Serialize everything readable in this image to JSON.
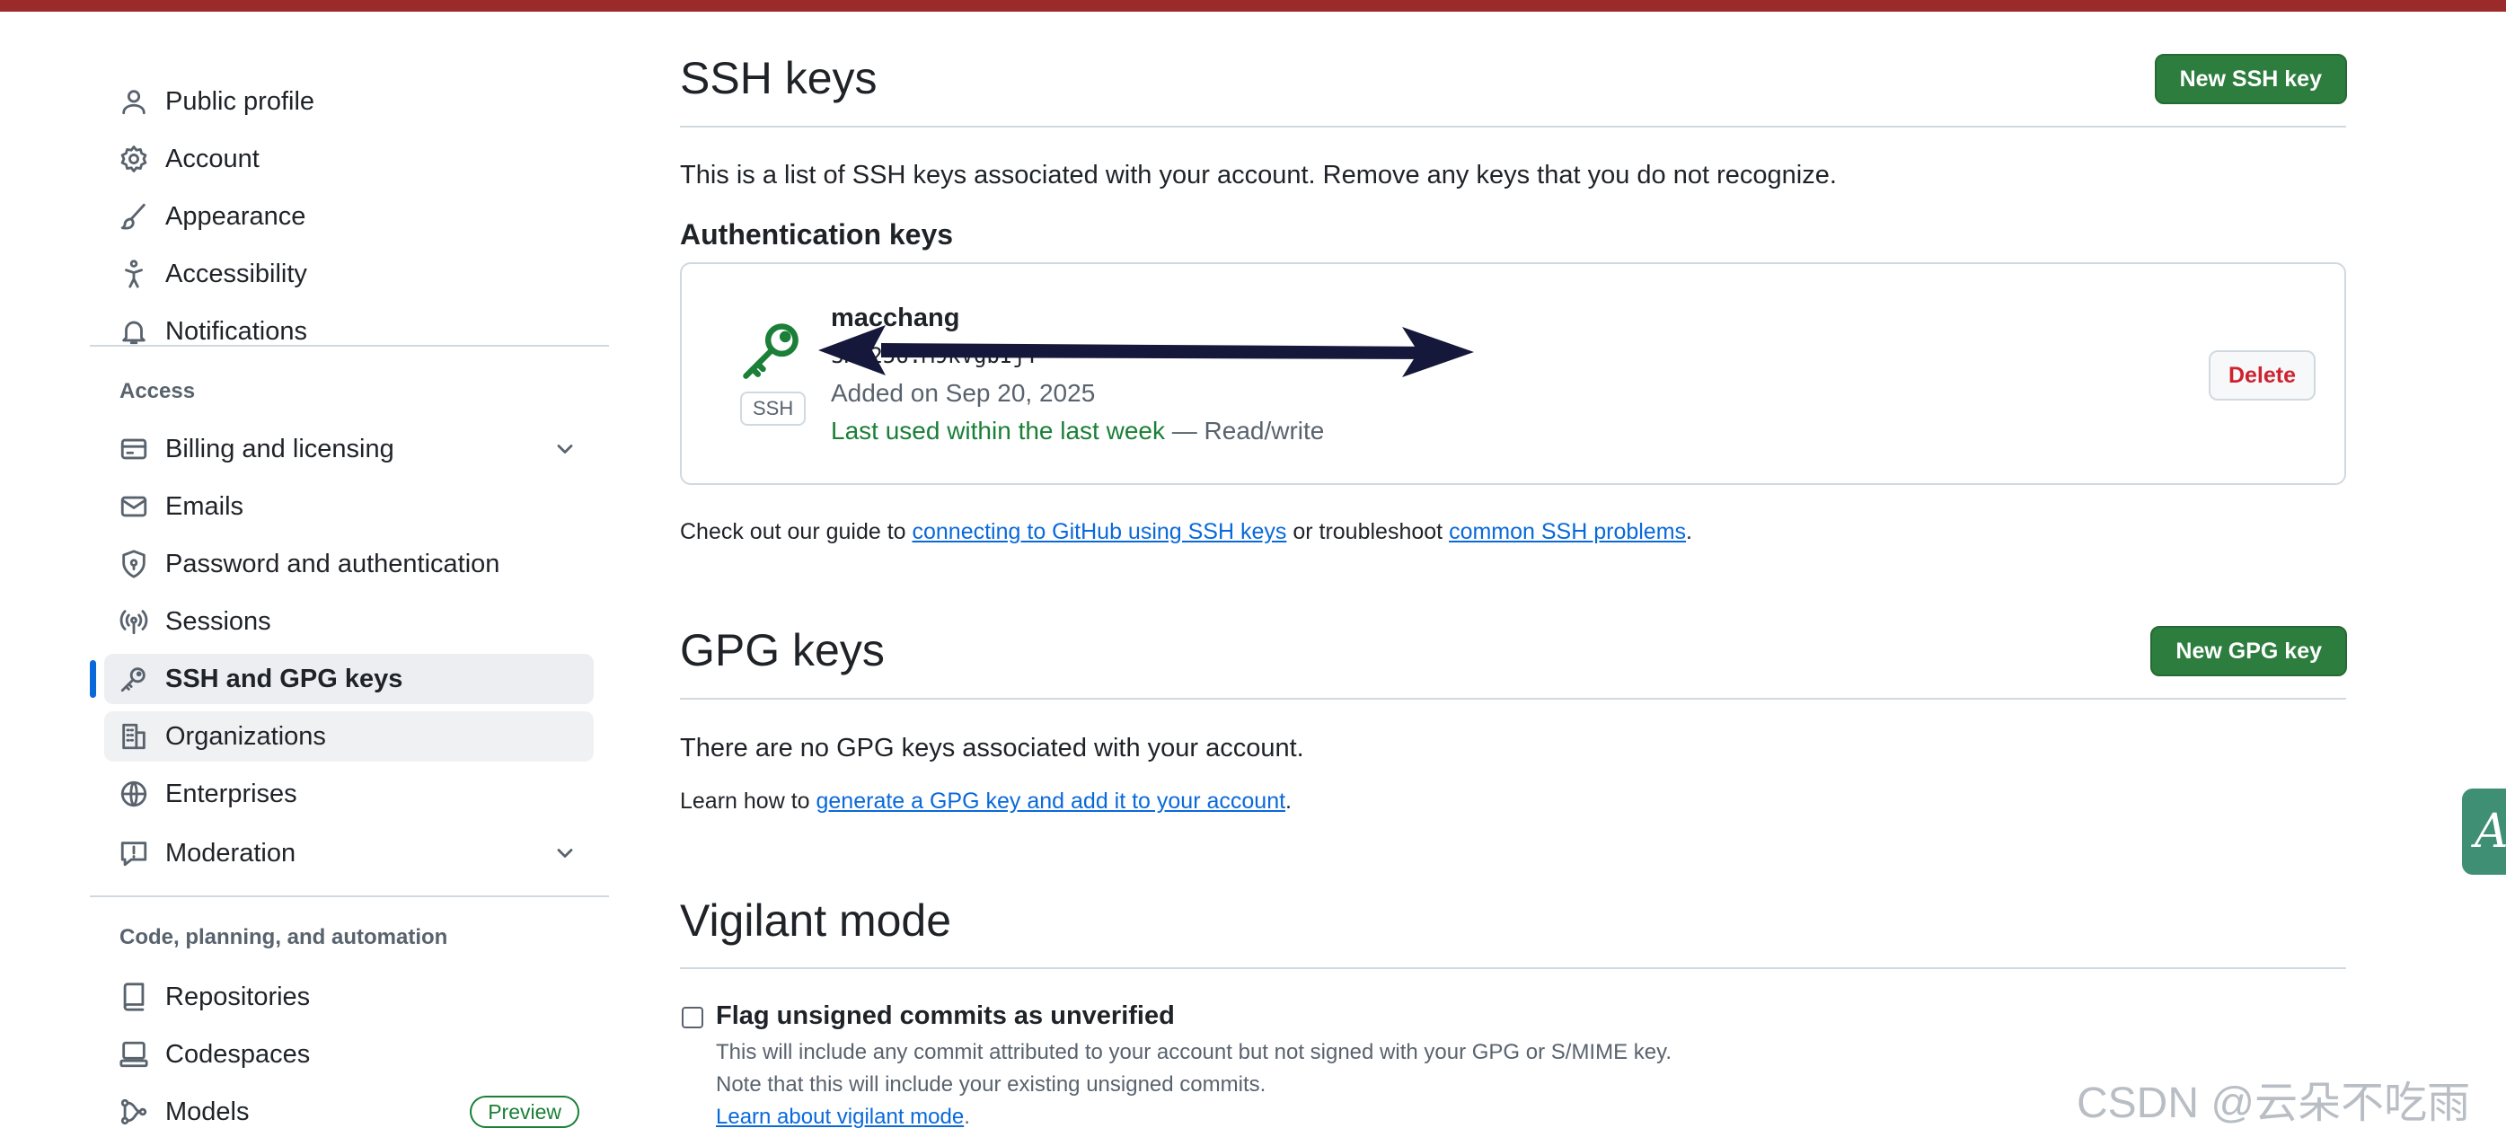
{
  "sidebar": {
    "top_items": [
      {
        "label": "Public profile",
        "icon": "person-icon"
      },
      {
        "label": "Account",
        "icon": "gear-icon"
      },
      {
        "label": "Appearance",
        "icon": "paintbrush-icon"
      },
      {
        "label": "Accessibility",
        "icon": "accessibility-icon"
      },
      {
        "label": "Notifications",
        "icon": "bell-icon"
      }
    ],
    "access_heading": "Access",
    "access_items": [
      {
        "label": "Billing and licensing",
        "icon": "credit-card-icon",
        "expandable": true
      },
      {
        "label": "Emails",
        "icon": "mail-icon"
      },
      {
        "label": "Password and authentication",
        "icon": "shield-lock-icon"
      },
      {
        "label": "Sessions",
        "icon": "broadcast-icon"
      },
      {
        "label": "SSH and GPG keys",
        "icon": "key-icon",
        "active": true
      },
      {
        "label": "Organizations",
        "icon": "organization-icon"
      },
      {
        "label": "Enterprises",
        "icon": "globe-icon"
      },
      {
        "label": "Moderation",
        "icon": "report-icon",
        "expandable": true
      }
    ],
    "code_heading": "Code, planning, and automation",
    "code_items": [
      {
        "label": "Repositories",
        "icon": "repo-icon"
      },
      {
        "label": "Codespaces",
        "icon": "codespaces-icon"
      },
      {
        "label": "Models",
        "icon": "models-icon",
        "badge": "Preview"
      }
    ]
  },
  "ssh": {
    "title": "SSH keys",
    "new_button": "New SSH key",
    "intro": "This is a list of SSH keys associated with your account. Remove any keys that you do not recognize.",
    "auth_heading": "Authentication keys",
    "key": {
      "name": "macchang",
      "badge": "SSH",
      "fingerprint": "SHA256:M9kVgbIjT",
      "added": "Added on Sep 20, 2025",
      "last_used": "Last used within the last week",
      "access": " — Read/write",
      "delete_button": "Delete"
    },
    "guide_prefix": "Check out our guide to ",
    "guide_link1": "connecting to GitHub using SSH keys",
    "guide_middle": " or troubleshoot ",
    "guide_link2": "common SSH problems",
    "guide_suffix": "."
  },
  "gpg": {
    "title": "GPG keys",
    "new_button": "New GPG key",
    "empty": "There are no GPG keys associated with your account.",
    "learn_prefix": "Learn how to ",
    "learn_link": "generate a GPG key and add it to your account",
    "learn_suffix": "."
  },
  "vigilant": {
    "title": "Vigilant mode",
    "checkbox_label": "Flag unsigned commits as unverified",
    "checked": false,
    "desc1": "This will include any commit attributed to your account but not signed with your GPG or S/MIME key.",
    "desc2": "Note that this will include your existing unsigned commits.",
    "learn_link": "Learn about vigilant mode",
    "learn_suffix": "."
  },
  "watermark": "CSDN @云朵不吃雨",
  "colors": {
    "accent": "#0969da",
    "green": "#1a7f37",
    "danger": "#cf222e",
    "topbar": "#9b2a2a"
  }
}
